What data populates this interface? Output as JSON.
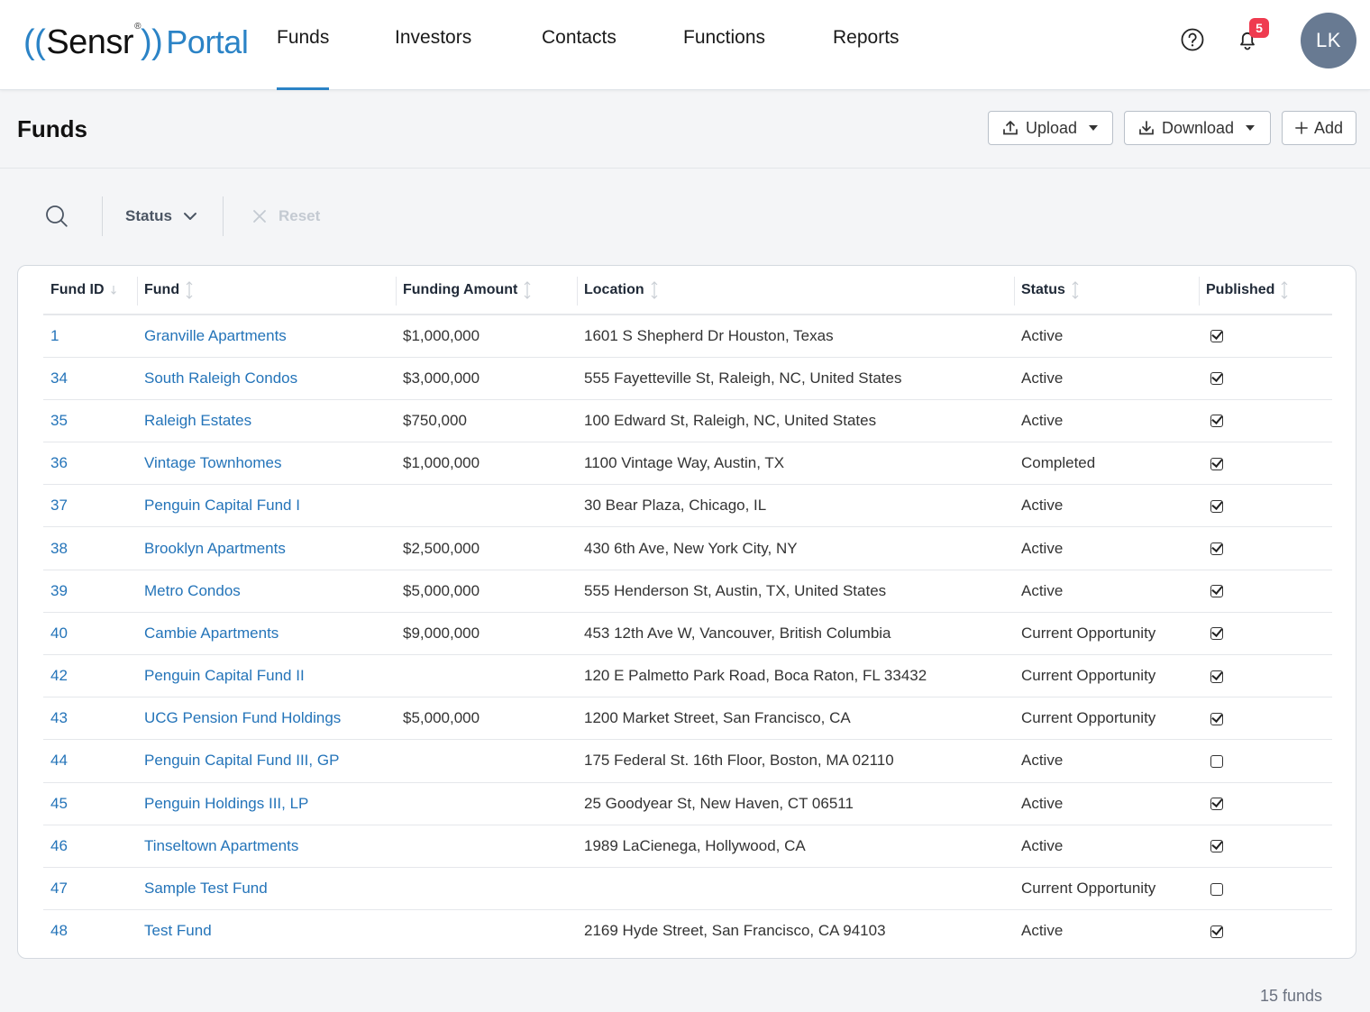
{
  "brand": {
    "logo_open": "((",
    "logo_name": "Sensr",
    "logo_close": "))",
    "logo_reg": "®",
    "logo_portal": "Portal",
    "accent": "#2b83c6"
  },
  "nav": {
    "items": [
      "Funds",
      "Investors",
      "Contacts",
      "Functions",
      "Reports"
    ],
    "active": "Funds"
  },
  "header_actions": {
    "notification_count": "5",
    "avatar_initials": "LK"
  },
  "page": {
    "title": "Funds",
    "upload_label": "Upload",
    "download_label": "Download",
    "add_label": "Add"
  },
  "filters": {
    "status_label": "Status",
    "reset_label": "Reset"
  },
  "table": {
    "columns": [
      "Fund ID",
      "Fund",
      "Funding Amount",
      "Location",
      "Status",
      "Published"
    ],
    "rows": [
      {
        "id": "1",
        "fund": "Granville Apartments",
        "amount": "$1,000,000",
        "location": "1601 S Shepherd Dr Houston, Texas",
        "status": "Active",
        "published": true
      },
      {
        "id": "34",
        "fund": "South Raleigh Condos",
        "amount": "$3,000,000",
        "location": "555 Fayetteville St, Raleigh, NC, United States",
        "status": "Active",
        "published": true
      },
      {
        "id": "35",
        "fund": "Raleigh Estates",
        "amount": "$750,000",
        "location": "100 Edward St, Raleigh, NC, United States",
        "status": "Active",
        "published": true
      },
      {
        "id": "36",
        "fund": "Vintage Townhomes",
        "amount": "$1,000,000",
        "location": "1100 Vintage Way, Austin, TX",
        "status": "Completed",
        "published": true
      },
      {
        "id": "37",
        "fund": "Penguin Capital Fund I",
        "amount": "",
        "location": "30 Bear Plaza, Chicago, IL",
        "status": "Active",
        "published": true
      },
      {
        "id": "38",
        "fund": "Brooklyn Apartments",
        "amount": "$2,500,000",
        "location": "430 6th Ave, New York City, NY",
        "status": "Active",
        "published": true
      },
      {
        "id": "39",
        "fund": "Metro Condos",
        "amount": "$5,000,000",
        "location": "555 Henderson St, Austin, TX, United States",
        "status": "Active",
        "published": true
      },
      {
        "id": "40",
        "fund": "Cambie Apartments",
        "amount": "$9,000,000",
        "location": "453 12th Ave W, Vancouver, British Columbia",
        "status": "Current Opportunity",
        "published": true
      },
      {
        "id": "42",
        "fund": "Penguin Capital Fund II",
        "amount": "",
        "location": "120 E Palmetto Park Road, Boca Raton, FL 33432",
        "status": "Current Opportunity",
        "published": true
      },
      {
        "id": "43",
        "fund": "UCG Pension Fund Holdings",
        "amount": "$5,000,000",
        "location": "1200 Market Street, San Francisco, CA",
        "status": "Current Opportunity",
        "published": true
      },
      {
        "id": "44",
        "fund": "Penguin Capital Fund III, GP",
        "amount": "",
        "location": "175 Federal St. 16th Floor, Boston, MA 02110",
        "status": "Active",
        "published": false
      },
      {
        "id": "45",
        "fund": "Penguin Holdings III, LP",
        "amount": "",
        "location": "25 Goodyear St, New Haven, CT 06511",
        "status": "Active",
        "published": true
      },
      {
        "id": "46",
        "fund": "Tinseltown Apartments",
        "amount": "",
        "location": "1989 LaCienega, Hollywood, CA",
        "status": "Active",
        "published": true
      },
      {
        "id": "47",
        "fund": "Sample Test Fund",
        "amount": "",
        "location": "",
        "status": "Current Opportunity",
        "published": false
      },
      {
        "id": "48",
        "fund": "Test Fund",
        "amount": "",
        "location": "2169 Hyde Street, San Francisco, CA 94103",
        "status": "Active",
        "published": true
      }
    ]
  },
  "footer": {
    "count_label": "15 funds"
  }
}
